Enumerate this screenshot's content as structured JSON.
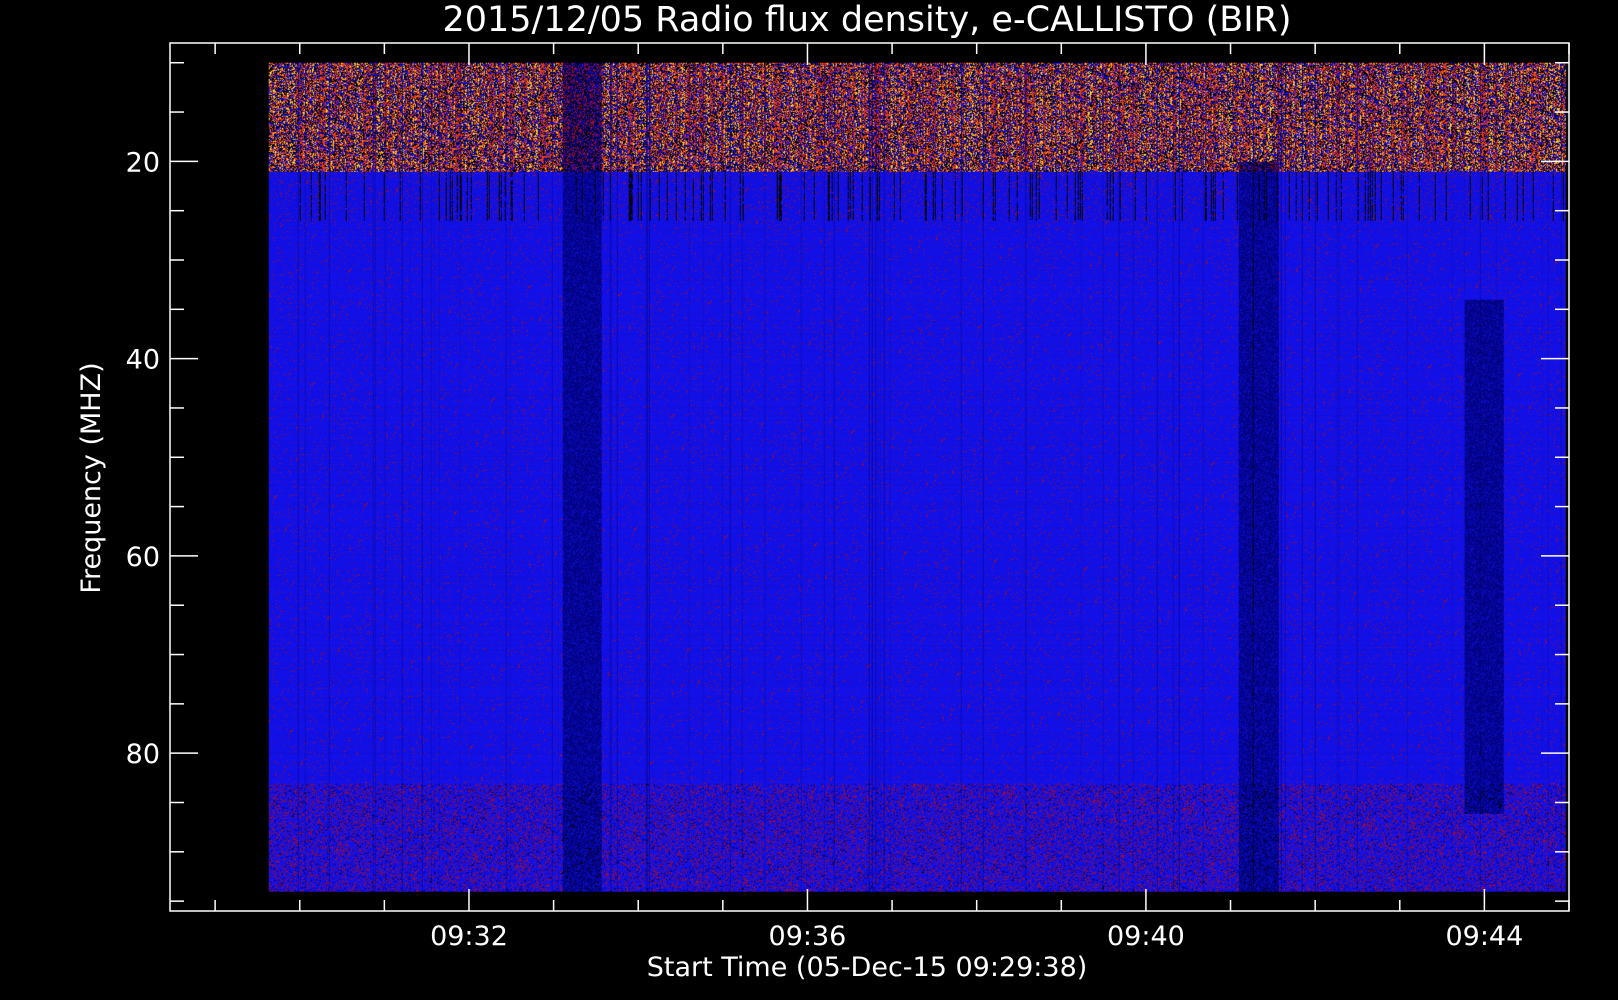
{
  "chart_data": {
    "type": "heatmap",
    "title": "2015/12/05  Radio flux density, e-CALLISTO (BIR)",
    "xlabel": "Start Time (05-Dec-15 09:29:38)",
    "ylabel": "Frequency (MHZ)",
    "x_unit": "UT time",
    "xlim": [
      "09:28:28",
      "09:45:00"
    ],
    "data_x_range": [
      "09:29:38",
      "09:44:58"
    ],
    "ylim": [
      8,
      96
    ],
    "y_reversed": true,
    "data_y_range": [
      10,
      94
    ],
    "x_major_ticks": [
      "09:32",
      "09:36",
      "09:40",
      "09:44"
    ],
    "x_minor_step_minutes": 1,
    "y_major_ticks": [
      20,
      40,
      60,
      80
    ],
    "y_minor_step": 5,
    "grid": false,
    "legend": "none",
    "colormap": [
      "#000000",
      "#0000ff",
      "#a00000",
      "#ff4000",
      "#ffc000"
    ],
    "colors": {
      "background": "#000000",
      "frame": "#ffffff",
      "dominant": "#1a18ee",
      "burst": "#ff5010"
    },
    "bands": [
      {
        "freq_range": [
          10,
          21
        ],
        "character": "intense bright emission, yellow/orange/red with black dropouts"
      },
      {
        "freq_range": [
          21,
          26
        ],
        "character": "dark vertical streaks on blue"
      },
      {
        "freq_range": [
          26,
          83
        ],
        "character": "uniform blue background with faint red striations"
      },
      {
        "freq_range": [
          83,
          94
        ],
        "character": "speckled red/blue noise band"
      }
    ],
    "features": [
      {
        "time": "09:44:00",
        "freq_range": [
          34,
          86
        ],
        "description": "dark vertical band"
      },
      {
        "time": "09:33:20",
        "freq_range": [
          10,
          94
        ],
        "description": "dark vertical stripe"
      },
      {
        "time": "09:41:20",
        "freq_range": [
          20,
          94
        ],
        "description": "faint vertical stripe"
      }
    ]
  }
}
